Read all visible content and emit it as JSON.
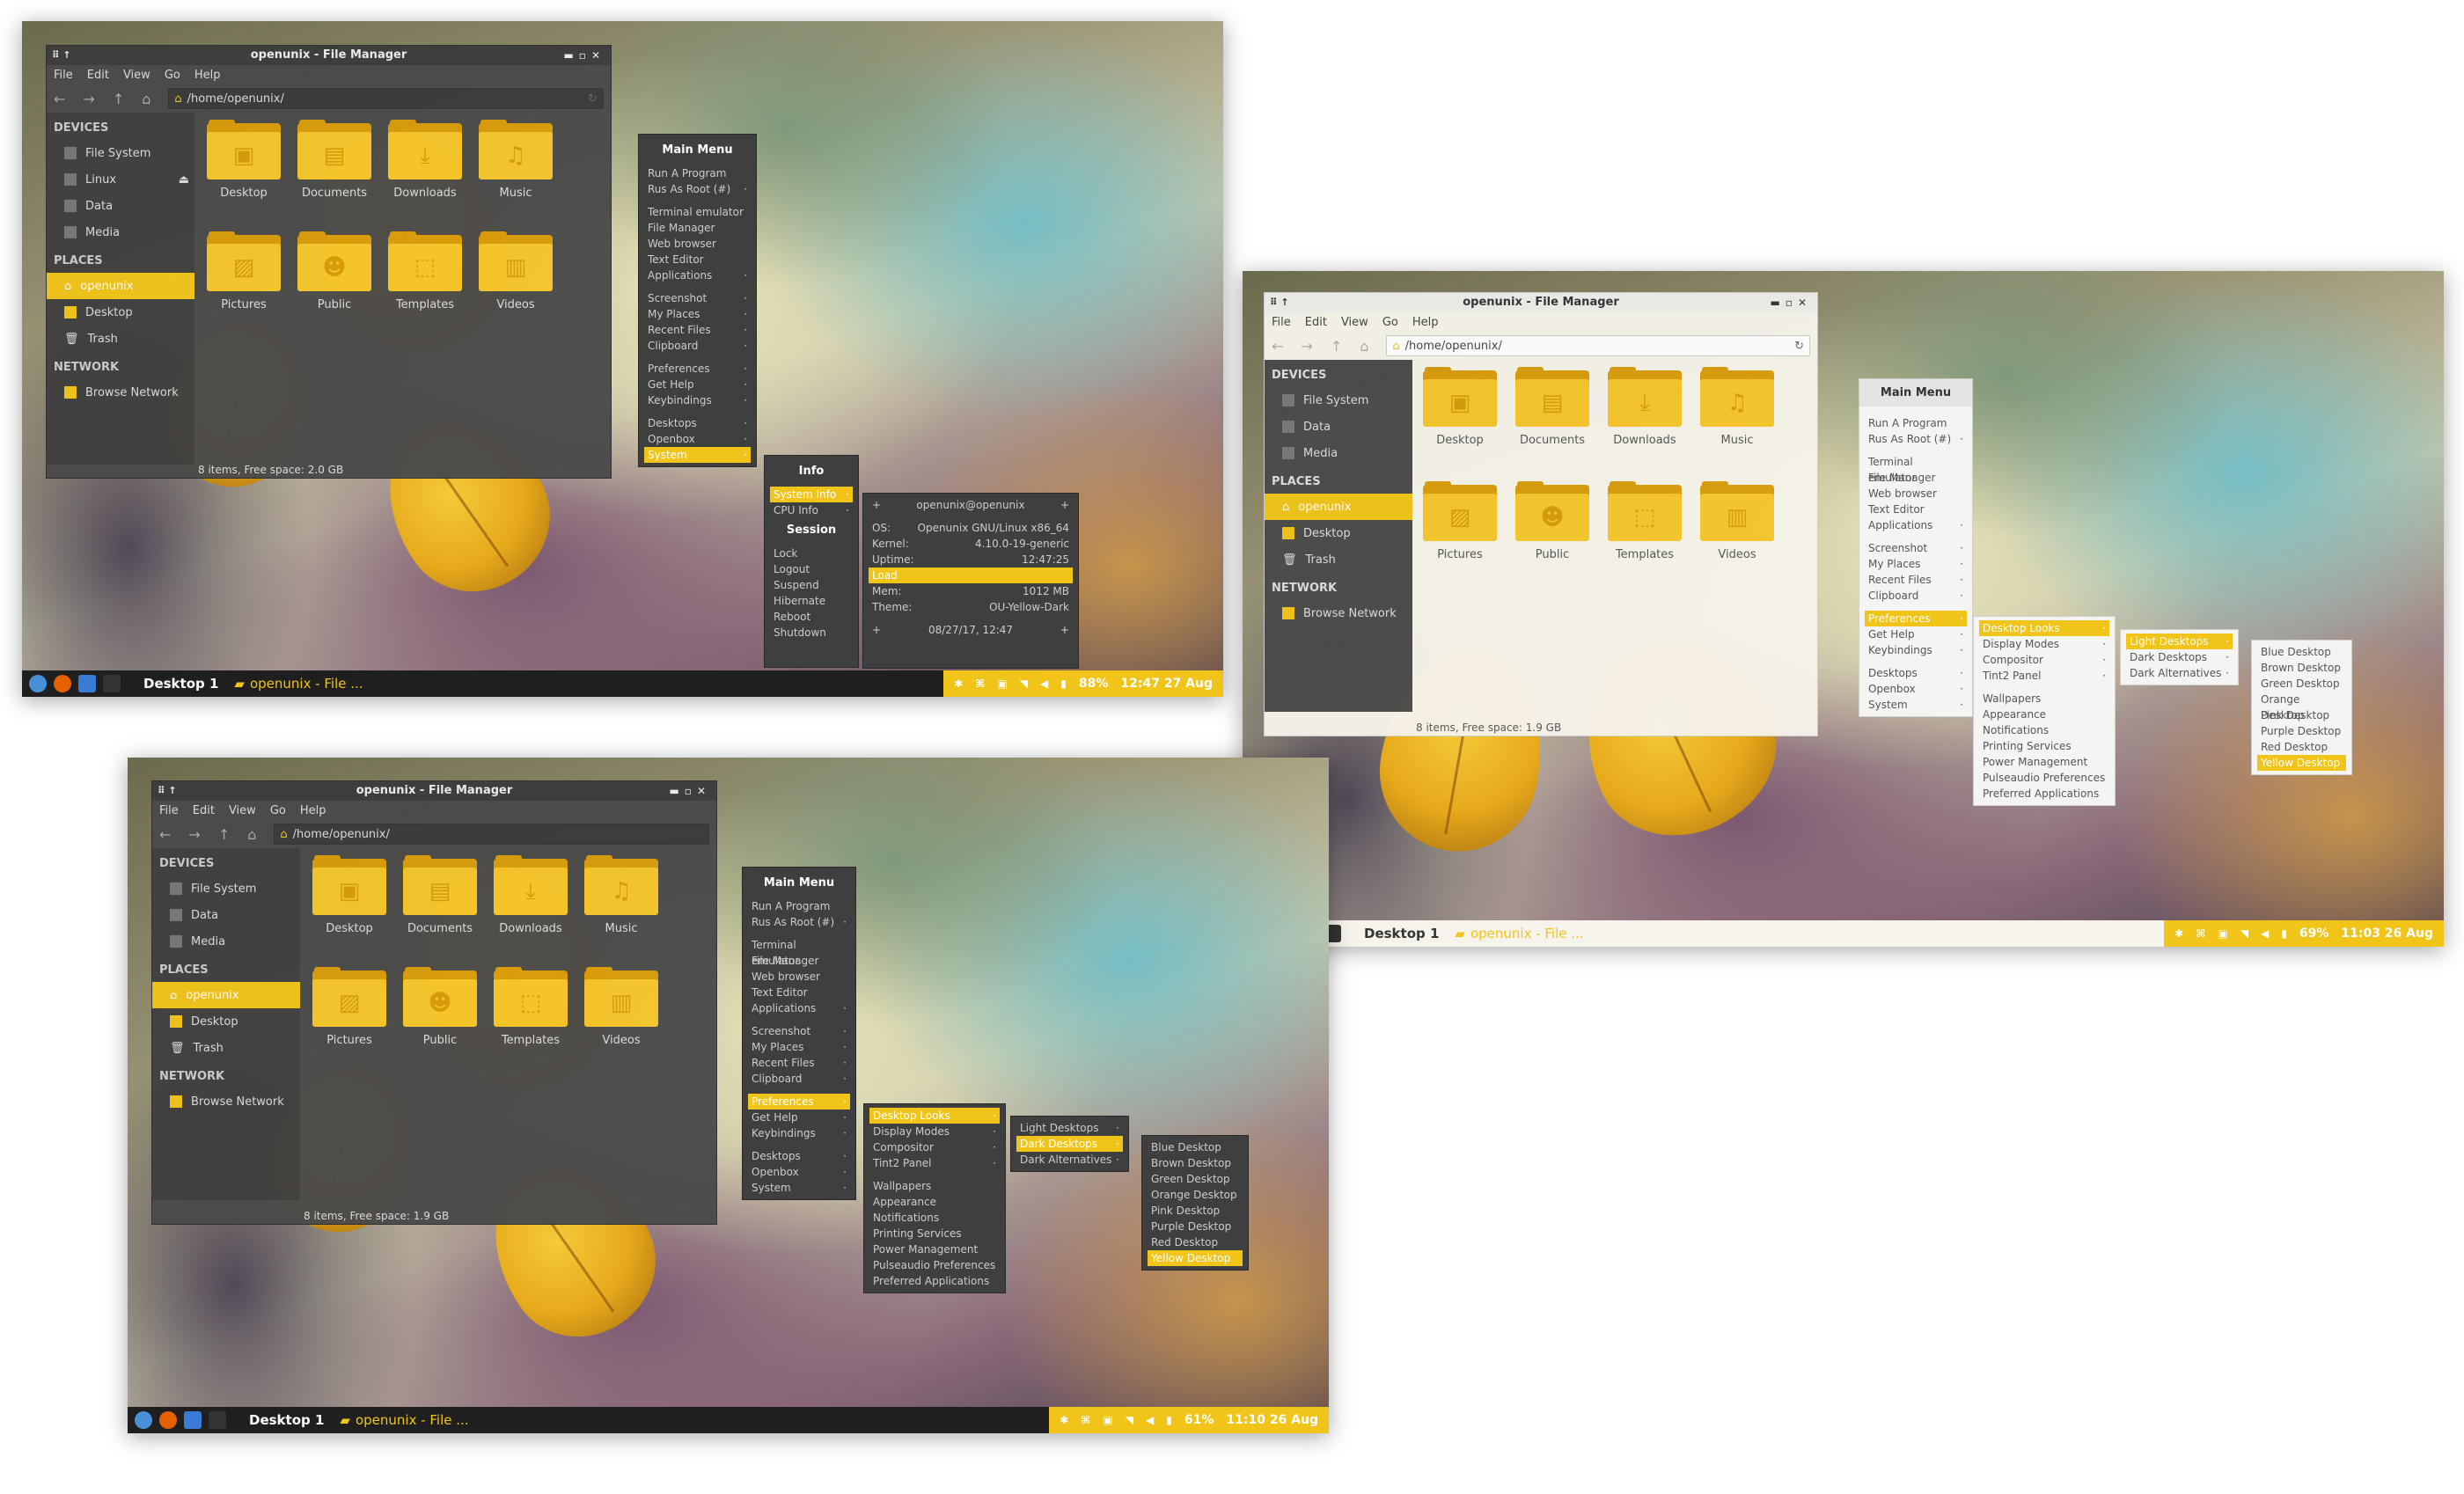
{
  "colors": {
    "accent": "#f0c419",
    "folder_front": "#f5c52a",
    "folder_back": "#d99b0a",
    "dark_bg": "#4a4a4a",
    "light_bg": "#f6f3ea"
  },
  "file_manager": {
    "title": "openunix - File Manager",
    "menus": [
      "File",
      "Edit",
      "View",
      "Go",
      "Help"
    ],
    "path": "/home/openunix/",
    "sections": {
      "devices": "DEVICES",
      "places": "PLACES",
      "network": "NETWORK"
    },
    "devices_a": [
      "File System",
      "Linux",
      "Data",
      "Media"
    ],
    "devices_b": [
      "File System",
      "Data",
      "Media"
    ],
    "places": [
      "openunix",
      "Desktop",
      "Trash"
    ],
    "network": [
      "Browse Network"
    ],
    "folders": [
      "Desktop",
      "Documents",
      "Downloads",
      "Music",
      "Pictures",
      "Public",
      "Templates",
      "Videos"
    ],
    "folder_icons": [
      "monitor-icon",
      "document-icon",
      "download-icon",
      "music-icon",
      "image-icon",
      "people-icon",
      "template-icon",
      "film-icon"
    ],
    "status_a": "8 items, Free space: 2.0 GB",
    "status_b": "8 items, Free space: 1.9 GB"
  },
  "main_menu": {
    "title": "Main Menu",
    "items": [
      "Run A Program",
      "Rus As Root (#)",
      "Terminal emulator",
      "File Manager",
      "Web browser",
      "Text Editor",
      "Applications",
      "Screenshot",
      "My Places",
      "Recent Files",
      "Clipboard",
      "Preferences",
      "Get Help",
      "Keybindings",
      "Desktops",
      "Openbox",
      "System"
    ]
  },
  "info_menu": {
    "info_title": "Info",
    "info_items": [
      "System Info",
      "CPU Info"
    ],
    "session_title": "Session",
    "session_items": [
      "Lock",
      "Logout",
      "Suspend",
      "Hibernate",
      "Reboot",
      "Shutdown"
    ]
  },
  "sysinfo": {
    "user": "openunix@openunix",
    "os_label": "OS:",
    "os": "Openunix GNU/Linux x86_64",
    "kernel_label": "Kernel:",
    "kernel": "4.10.0-19-generic",
    "uptime_label": "Uptime:",
    "uptime": "12:47:25",
    "load": "Load",
    "mem_label": "Mem:",
    "mem": "1012 MB",
    "theme_label": "Theme:",
    "theme": "OU-Yellow-Dark",
    "date": "08/27/17, 12:47"
  },
  "prefs_menu": [
    "Desktop Looks",
    "Display Modes",
    "Compositor",
    "Tint2 Panel",
    "Wallpapers",
    "Appearance",
    "Notifications",
    "Printing Services",
    "Power Management",
    "Pulseaudio Preferences",
    "Preferred Applications"
  ],
  "looks_menu": [
    "Light Desktops",
    "Dark Desktops",
    "Dark Alternatives"
  ],
  "color_menu": [
    "Blue Desktop",
    "Brown Desktop",
    "Green Desktop",
    "Orange Desktop",
    "Pink Desktop",
    "Purple Desktop",
    "Red Desktop",
    "Yellow Desktop"
  ],
  "taskbar": {
    "desktop": "Desktop 1",
    "task": "openunix - File ...",
    "a": {
      "battery": "88%",
      "clock": "12:47 27 Aug"
    },
    "b": {
      "battery": "69%",
      "clock": "11:03 26 Aug"
    },
    "c": {
      "battery": "61%",
      "clock": "11:10 26 Aug"
    }
  }
}
